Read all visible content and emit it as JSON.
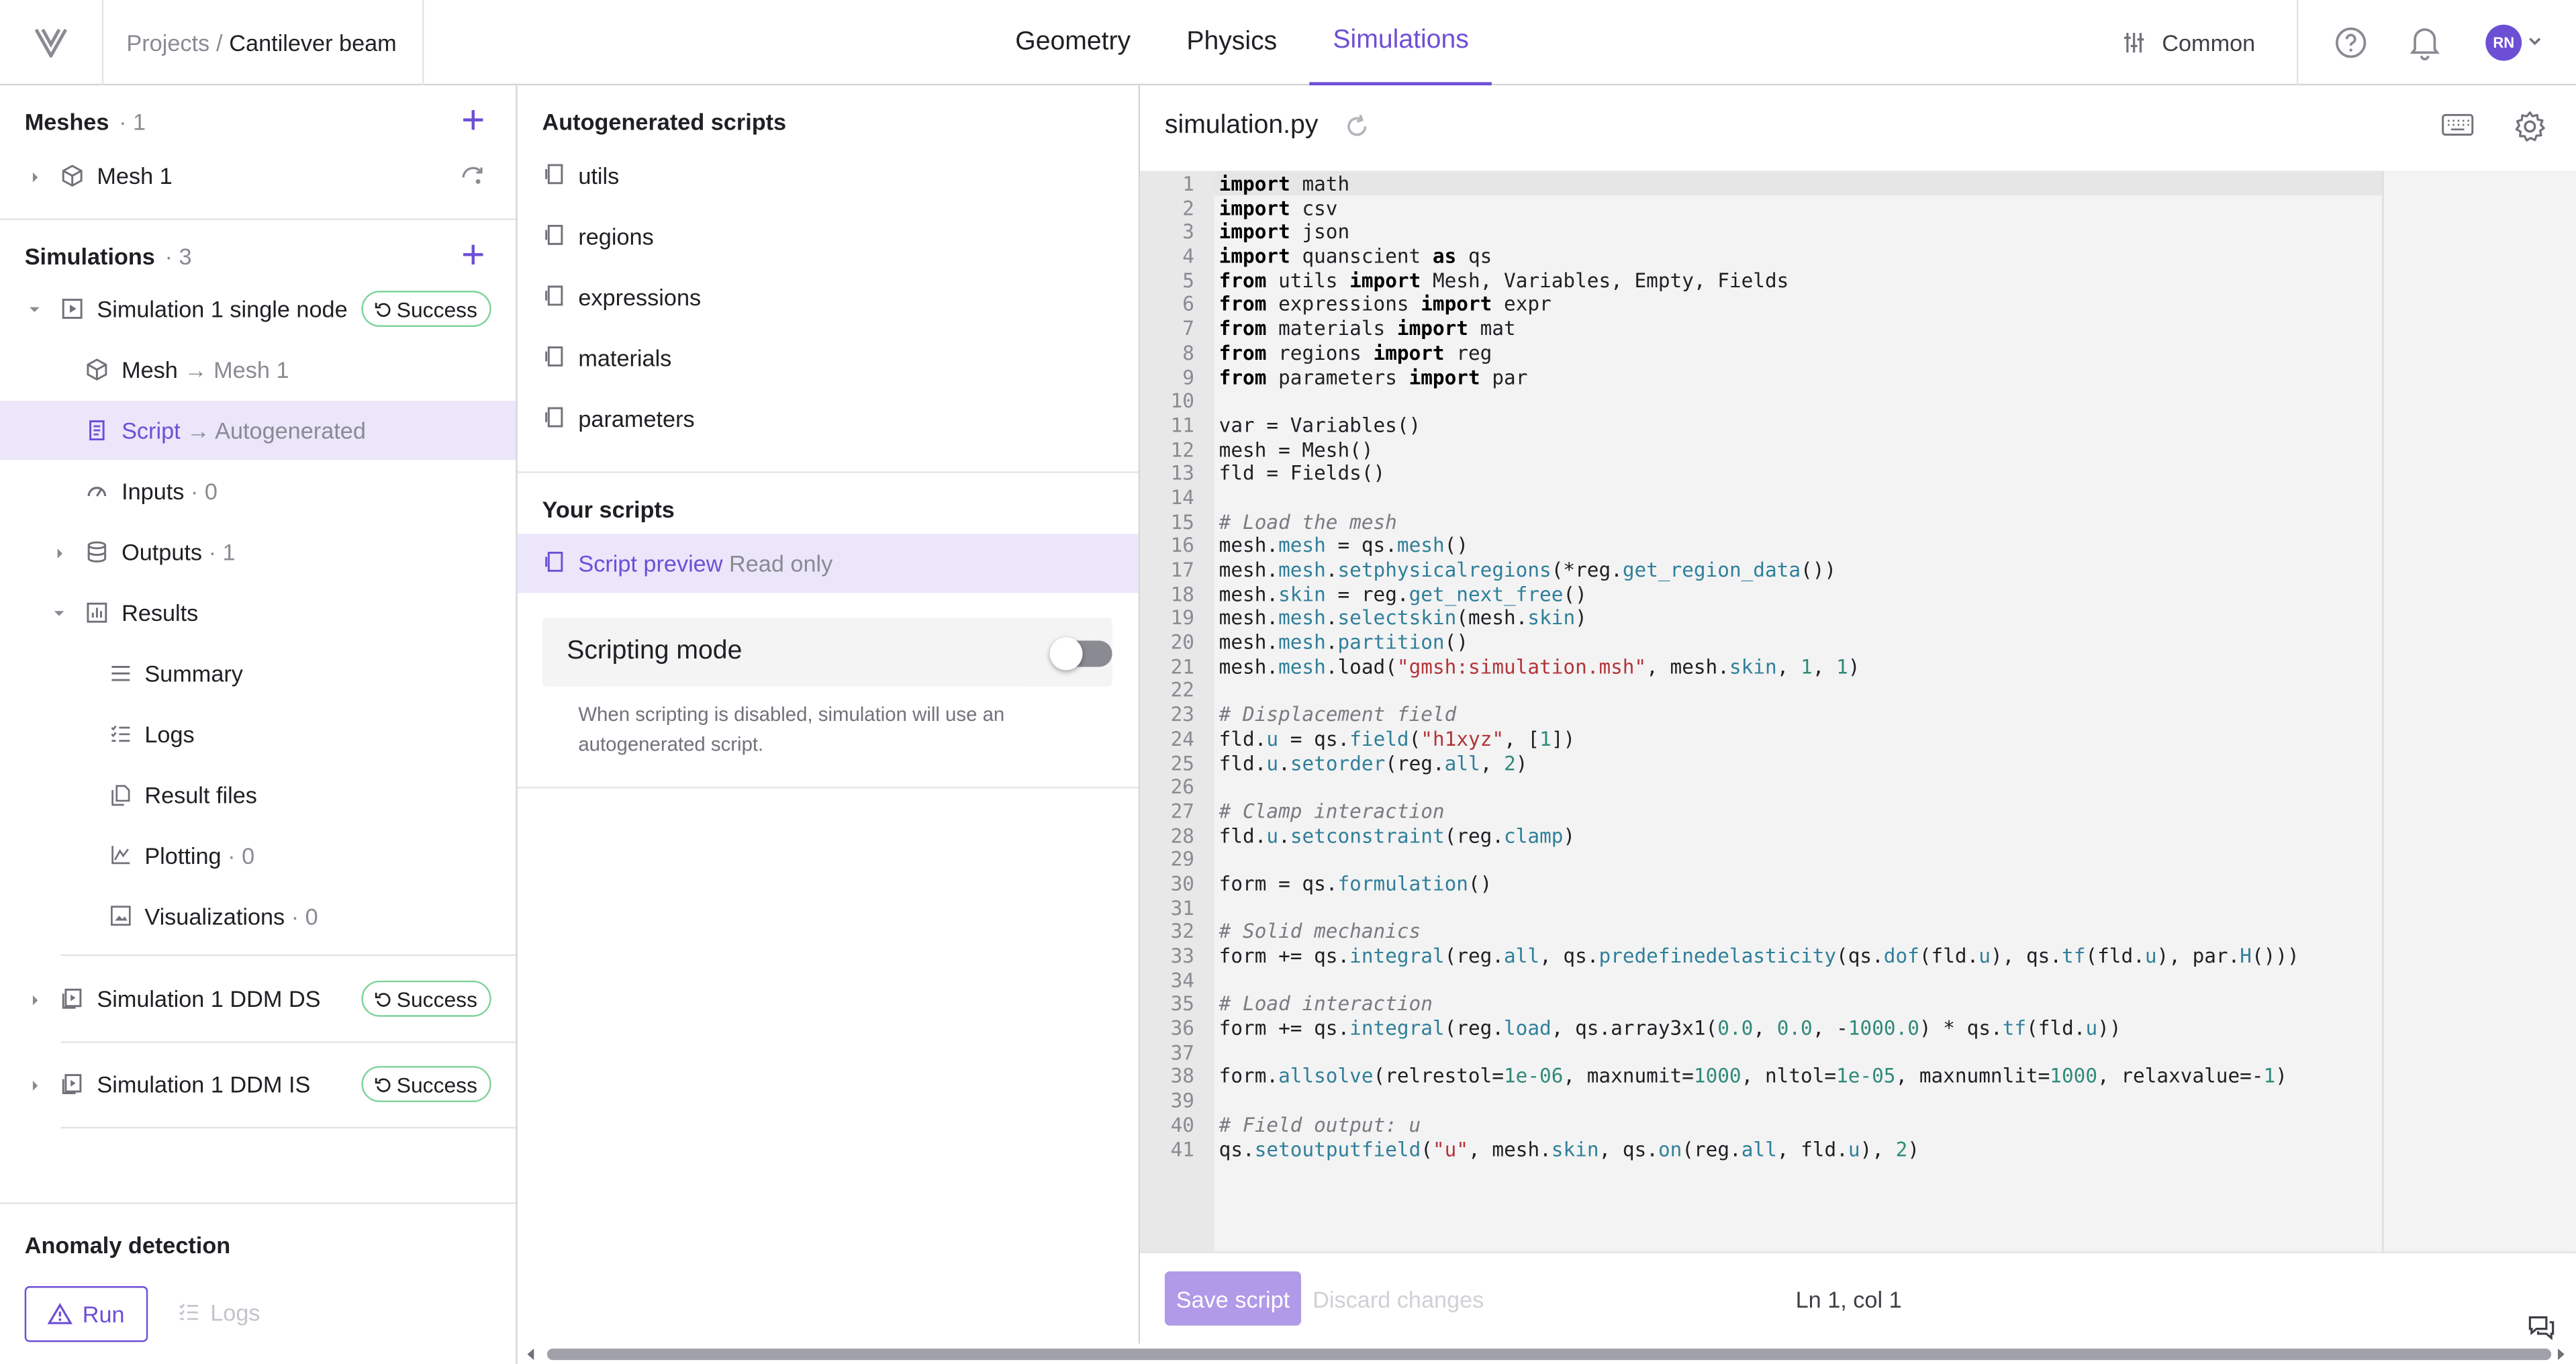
{
  "header": {
    "breadcrumb_root": "Projects",
    "breadcrumb_sep": "/",
    "breadcrumb_current": "Cantilever beam",
    "tabs": [
      {
        "label": "Geometry",
        "active": false
      },
      {
        "label": "Physics",
        "active": false
      },
      {
        "label": "Simulations",
        "active": true
      }
    ],
    "common_label": "Common",
    "avatar_initials": "RN",
    "accent_color": "#6d4fd6"
  },
  "left": {
    "meshes_title": "Meshes",
    "meshes_count": "1",
    "mesh_item": "Mesh 1",
    "simulations_title": "Simulations",
    "simulations_count": "3",
    "sim1_label": "Simulation 1 single node",
    "sim1_status": "Success",
    "mesh_row": {
      "label": "Mesh",
      "target": "Mesh 1"
    },
    "script_row": {
      "label": "Script",
      "target": "Autogenerated"
    },
    "inputs_row": {
      "label": "Inputs",
      "count": "0"
    },
    "outputs_row": {
      "label": "Outputs",
      "count": "1"
    },
    "results_label": "Results",
    "results_items": [
      {
        "label": "Summary",
        "count": ""
      },
      {
        "label": "Logs",
        "count": ""
      },
      {
        "label": "Result files",
        "count": ""
      },
      {
        "label": "Plotting",
        "count": "0"
      },
      {
        "label": "Visualizations",
        "count": "0"
      }
    ],
    "sim2_label": "Simulation 1 DDM DS",
    "sim2_status": "Success",
    "sim3_label": "Simulation 1 DDM IS",
    "sim3_status": "Success",
    "anomaly_title": "Anomaly detection",
    "run_label": "Run",
    "logs_label": "Logs",
    "status_color": "#7fd39a"
  },
  "middle": {
    "auto_title": "Autogenerated scripts",
    "auto_scripts": [
      "utils",
      "regions",
      "expressions",
      "materials",
      "parameters"
    ],
    "your_title": "Your scripts",
    "preview_label": "Script preview",
    "preview_suffix": "Read only",
    "scripting_mode_label": "Scripting mode",
    "scripting_mode_on": false,
    "scripting_note": "When scripting is disabled, simulation will use an autogenerated script."
  },
  "editor": {
    "filename": "simulation.py",
    "save_label": "Save script",
    "discard_label": "Discard changes",
    "cursor_pos": "Ln 1, col 1",
    "code_lines": [
      [
        [
          "import",
          "k"
        ],
        [
          " math",
          "t"
        ]
      ],
      [
        [
          "import",
          "k"
        ],
        [
          " csv",
          "t"
        ]
      ],
      [
        [
          "import",
          "k"
        ],
        [
          " json",
          "t"
        ]
      ],
      [
        [
          "import",
          "k"
        ],
        [
          " quanscient ",
          "t"
        ],
        [
          "as",
          "k"
        ],
        [
          " qs",
          "t"
        ]
      ],
      [
        [
          "from",
          "k"
        ],
        [
          " utils ",
          "t"
        ],
        [
          "import",
          "k"
        ],
        [
          " Mesh, Variables, Empty, Fields",
          "t"
        ]
      ],
      [
        [
          "from",
          "k"
        ],
        [
          " expressions ",
          "t"
        ],
        [
          "import",
          "k"
        ],
        [
          " expr",
          "t"
        ]
      ],
      [
        [
          "from",
          "k"
        ],
        [
          " materials ",
          "t"
        ],
        [
          "import",
          "k"
        ],
        [
          " mat",
          "t"
        ]
      ],
      [
        [
          "from",
          "k"
        ],
        [
          " regions ",
          "t"
        ],
        [
          "import",
          "k"
        ],
        [
          " reg",
          "t"
        ]
      ],
      [
        [
          "from",
          "k"
        ],
        [
          " parameters ",
          "t"
        ],
        [
          "import",
          "k"
        ],
        [
          " par",
          "t"
        ]
      ],
      [],
      [
        [
          "var = Variables()",
          "t"
        ]
      ],
      [
        [
          "mesh = Mesh()",
          "t"
        ]
      ],
      [
        [
          "fld = Fields()",
          "t"
        ]
      ],
      [],
      [
        [
          "# Load the mesh",
          "c"
        ]
      ],
      [
        [
          "mesh.",
          "t"
        ],
        [
          "mesh",
          "p"
        ],
        [
          " = qs.",
          "t"
        ],
        [
          "mesh",
          "p"
        ],
        [
          "()",
          "t"
        ]
      ],
      [
        [
          "mesh.",
          "t"
        ],
        [
          "mesh",
          "p"
        ],
        [
          ".",
          "t"
        ],
        [
          "setphysicalregions",
          "p"
        ],
        [
          "(*reg.",
          "t"
        ],
        [
          "get_region_data",
          "p"
        ],
        [
          "())",
          "t"
        ]
      ],
      [
        [
          "mesh.",
          "t"
        ],
        [
          "skin",
          "p"
        ],
        [
          " = reg.",
          "t"
        ],
        [
          "get_next_free",
          "p"
        ],
        [
          "()",
          "t"
        ]
      ],
      [
        [
          "mesh.",
          "t"
        ],
        [
          "mesh",
          "p"
        ],
        [
          ".",
          "t"
        ],
        [
          "selectskin",
          "p"
        ],
        [
          "(mesh.",
          "t"
        ],
        [
          "skin",
          "p"
        ],
        [
          ")",
          "t"
        ]
      ],
      [
        [
          "mesh.",
          "t"
        ],
        [
          "mesh",
          "p"
        ],
        [
          ".",
          "t"
        ],
        [
          "partition",
          "p"
        ],
        [
          "()",
          "t"
        ]
      ],
      [
        [
          "mesh.",
          "t"
        ],
        [
          "mesh",
          "p"
        ],
        [
          ".load(",
          "t"
        ],
        [
          "\"gmsh:simulation.msh\"",
          "s"
        ],
        [
          ", mesh.",
          "t"
        ],
        [
          "skin",
          "p"
        ],
        [
          ", ",
          "t"
        ],
        [
          "1",
          "n"
        ],
        [
          ", ",
          "t"
        ],
        [
          "1",
          "n"
        ],
        [
          ")",
          "t"
        ]
      ],
      [],
      [
        [
          "# Displacement field",
          "c"
        ]
      ],
      [
        [
          "fld.",
          "t"
        ],
        [
          "u",
          "p"
        ],
        [
          " = qs.",
          "t"
        ],
        [
          "field",
          "p"
        ],
        [
          "(",
          "t"
        ],
        [
          "\"h1xyz\"",
          "s"
        ],
        [
          ", [",
          "t"
        ],
        [
          "1",
          "n"
        ],
        [
          "])",
          "t"
        ]
      ],
      [
        [
          "fld.",
          "t"
        ],
        [
          "u",
          "p"
        ],
        [
          ".",
          "t"
        ],
        [
          "setorder",
          "p"
        ],
        [
          "(reg.",
          "t"
        ],
        [
          "all",
          "p"
        ],
        [
          ", ",
          "t"
        ],
        [
          "2",
          "n"
        ],
        [
          ")",
          "t"
        ]
      ],
      [],
      [
        [
          "# Clamp interaction",
          "c"
        ]
      ],
      [
        [
          "fld.",
          "t"
        ],
        [
          "u",
          "p"
        ],
        [
          ".",
          "t"
        ],
        [
          "setconstraint",
          "p"
        ],
        [
          "(reg.",
          "t"
        ],
        [
          "clamp",
          "p"
        ],
        [
          ")",
          "t"
        ]
      ],
      [],
      [
        [
          "form = qs.",
          "t"
        ],
        [
          "formulation",
          "p"
        ],
        [
          "()",
          "t"
        ]
      ],
      [],
      [
        [
          "# Solid mechanics",
          "c"
        ]
      ],
      [
        [
          "form += qs.",
          "t"
        ],
        [
          "integral",
          "p"
        ],
        [
          "(reg.",
          "t"
        ],
        [
          "all",
          "p"
        ],
        [
          ", qs.",
          "t"
        ],
        [
          "predefinedelasticity",
          "p"
        ],
        [
          "(qs.",
          "t"
        ],
        [
          "dof",
          "p"
        ],
        [
          "(fld.",
          "t"
        ],
        [
          "u",
          "p"
        ],
        [
          "), qs.",
          "t"
        ],
        [
          "tf",
          "p"
        ],
        [
          "(fld.",
          "t"
        ],
        [
          "u",
          "p"
        ],
        [
          "), par.",
          "t"
        ],
        [
          "H",
          "p"
        ],
        [
          "()))",
          "t"
        ]
      ],
      [],
      [
        [
          "# Load interaction",
          "c"
        ]
      ],
      [
        [
          "form += qs.",
          "t"
        ],
        [
          "integral",
          "p"
        ],
        [
          "(reg.",
          "t"
        ],
        [
          "load",
          "p"
        ],
        [
          ", qs.array3x1(",
          "t"
        ],
        [
          "0.0",
          "n"
        ],
        [
          ", ",
          "t"
        ],
        [
          "0.0",
          "n"
        ],
        [
          ", -",
          "t"
        ],
        [
          "1000.0",
          "n"
        ],
        [
          ") * qs.",
          "t"
        ],
        [
          "tf",
          "p"
        ],
        [
          "(fld.",
          "t"
        ],
        [
          "u",
          "p"
        ],
        [
          "))",
          "t"
        ]
      ],
      [],
      [
        [
          "form.",
          "t"
        ],
        [
          "allsolve",
          "p"
        ],
        [
          "(relrestol=",
          "t"
        ],
        [
          "1e-06",
          "n"
        ],
        [
          ", maxnumit=",
          "t"
        ],
        [
          "1000",
          "n"
        ],
        [
          ", nltol=",
          "t"
        ],
        [
          "1e-05",
          "n"
        ],
        [
          ", maxnumnlit=",
          "t"
        ],
        [
          "1000",
          "n"
        ],
        [
          ", relaxvalue=-",
          "t"
        ],
        [
          "1",
          "n"
        ],
        [
          ")",
          "t"
        ]
      ],
      [],
      [
        [
          "# Field output: u",
          "c"
        ]
      ],
      [
        [
          "qs.",
          "t"
        ],
        [
          "setoutputfield",
          "p"
        ],
        [
          "(",
          "t"
        ],
        [
          "\"u\"",
          "s"
        ],
        [
          ", mesh.",
          "t"
        ],
        [
          "skin",
          "p"
        ],
        [
          ", qs.",
          "t"
        ],
        [
          "on",
          "p"
        ],
        [
          "(reg.",
          "t"
        ],
        [
          "all",
          "p"
        ],
        [
          ", fld.",
          "t"
        ],
        [
          "u",
          "p"
        ],
        [
          "), ",
          "t"
        ],
        [
          "2",
          "n"
        ],
        [
          ")",
          "t"
        ]
      ]
    ],
    "syntax_colors": {
      "k": "#000000",
      "t": "#1f1f24",
      "c": "#7a7a82",
      "p": "#2f7f9a",
      "s": "#b3343a",
      "n": "#2f8a7a"
    }
  }
}
